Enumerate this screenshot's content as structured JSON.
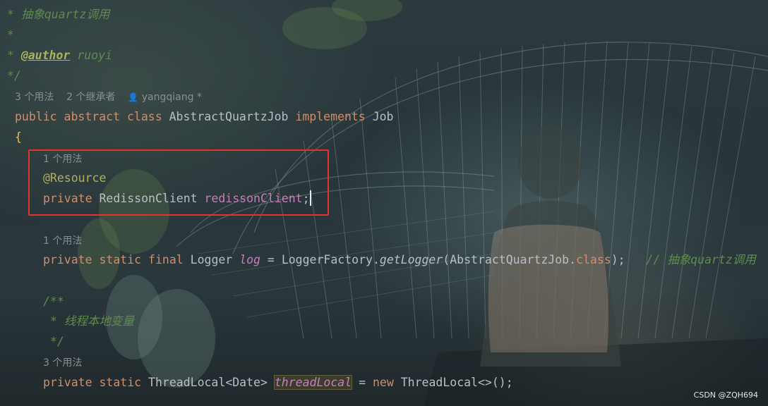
{
  "editor": {
    "doc_top": {
      "l1_star": " * ",
      "l1_text": "抽象quartz调用",
      "l2": " *",
      "l3_star": " * ",
      "l3_tag": "@author",
      "l3_value": " ruoyi",
      "l4": " */"
    },
    "class_hint": {
      "usages": "3 个用法",
      "inheritors": "2 个继承者",
      "author": "yangqiang *"
    },
    "class_decl": {
      "kw_public": "public",
      "kw_abstract": "abstract",
      "kw_class": "class",
      "name": "AbstractQuartzJob",
      "kw_implements": "implements",
      "iface": "Job"
    },
    "open_brace": "{",
    "field1": {
      "hint": "1 个用法",
      "annotation": "@Resource",
      "kw_private": "private",
      "type": "RedissonClient",
      "name": "redissonClient",
      "semi": ";"
    },
    "field2": {
      "hint": "1 个用法",
      "kw_private": "private",
      "kw_static": "static",
      "kw_final": "final",
      "type": "Logger",
      "name": "log",
      "eq": " = ",
      "factory": "LoggerFactory.",
      "method": "getLogger",
      "arg_open": "(AbstractQuartzJob.",
      "kw_class": "class",
      "arg_close": ");",
      "comment": "// 抽象quartz调用"
    },
    "doc2": {
      "open": "/**",
      "body_star": " * ",
      "body_text": "线程本地变量",
      "close": " */"
    },
    "field3": {
      "hint": "3 个用法",
      "kw_private": "private",
      "kw_static": "static",
      "type": "ThreadLocal",
      "generic_open": "<",
      "generic_type": "Date",
      "generic_close": ">",
      "name": "threadLocal",
      "eq": " = ",
      "kw_new": "new",
      "ctor": "ThreadLocal",
      "ctor_tail": "<>();"
    }
  },
  "watermark": "CSDN @ZQH694",
  "colors": {
    "keyword": "#cf8e6d",
    "annotation": "#b3ae60",
    "comment": "#5f8b4e",
    "field": "#c77dbb",
    "highlight_box": "#e5322d"
  }
}
